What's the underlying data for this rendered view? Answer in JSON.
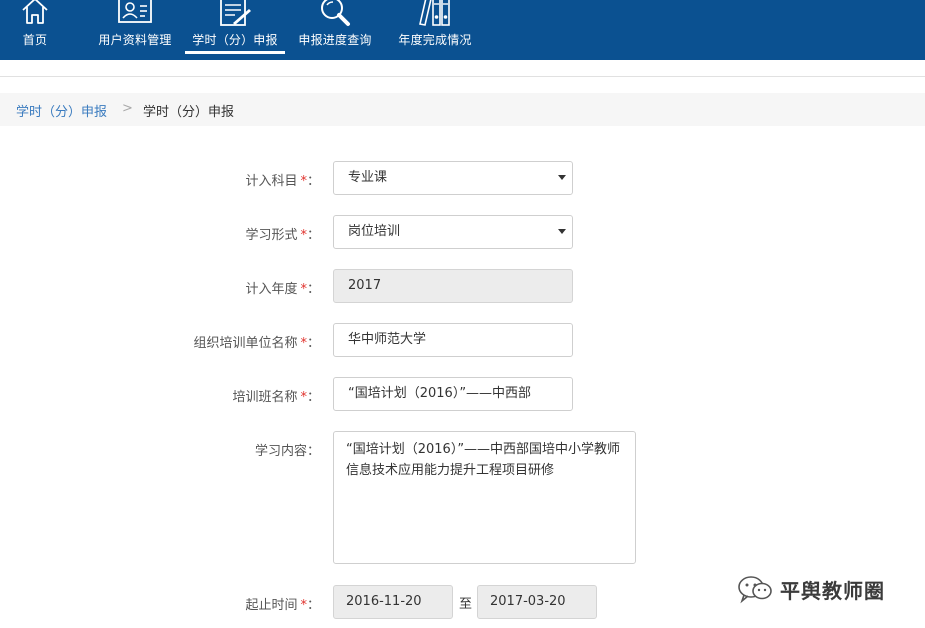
{
  "nav": {
    "items": [
      {
        "label": "首页",
        "icon": "home-icon"
      },
      {
        "label": "用户资料管理",
        "icon": "user-profile-icon"
      },
      {
        "label": "学时（分）申报",
        "icon": "document-edit-icon"
      },
      {
        "label": "申报进度查询",
        "icon": "search-icon"
      },
      {
        "label": "年度完成情况",
        "icon": "binders-icon"
      }
    ],
    "active_index": 2
  },
  "breadcrumb": {
    "link": "学时（分）申报",
    "separator": ">",
    "current": "学时（分）申报"
  },
  "form": {
    "subject": {
      "label": "计入科目",
      "required": "*",
      "value": "专业课"
    },
    "study_form": {
      "label": "学习形式",
      "required": "*",
      "value": "岗位培训"
    },
    "year": {
      "label": "计入年度",
      "required": "*",
      "value": "2017"
    },
    "org_name": {
      "label": "组织培训单位名称",
      "required": "*",
      "value": "华中师范大学"
    },
    "class_name": {
      "label": "培训班名称",
      "required": "*",
      "value": "“国培计划（2016）”——中西部"
    },
    "content": {
      "label": "学习内容",
      "value": "“国培计划（2016）”——中西部国培中小学教师信息技术应用能力提升工程项目研修"
    },
    "period": {
      "label": "起止时间",
      "required": "*",
      "start": "2016-11-20",
      "to": "至",
      "end": "2017-03-20"
    },
    "colon": "："
  },
  "watermark": {
    "text": "平舆教师圈",
    "icon": "wechat-icon"
  },
  "colors": {
    "nav_bg": "#0b5191",
    "link": "#3a7bbf",
    "required": "#e0302b",
    "readonly_bg": "#ececec"
  }
}
